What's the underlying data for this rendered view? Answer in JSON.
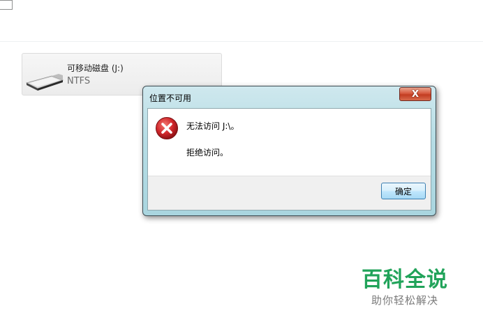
{
  "drive": {
    "name": "可移动磁盘 (J:)",
    "filesystem": "NTFS",
    "icon": "removable-drive-icon"
  },
  "dialog": {
    "title": "位置不可用",
    "close_label": "X",
    "icon": "error-icon",
    "message_line1": "无法访问 J:\\。",
    "message_line2": "拒绝访问。",
    "ok_label": "确定"
  },
  "watermark": {
    "title": "百科全说",
    "subtitle": "助你轻松解决"
  },
  "colors": {
    "close_button": "#c8452a",
    "dialog_frame": "#b6dde5",
    "error_red": "#d0272b",
    "watermark_green": "#21a35a"
  }
}
